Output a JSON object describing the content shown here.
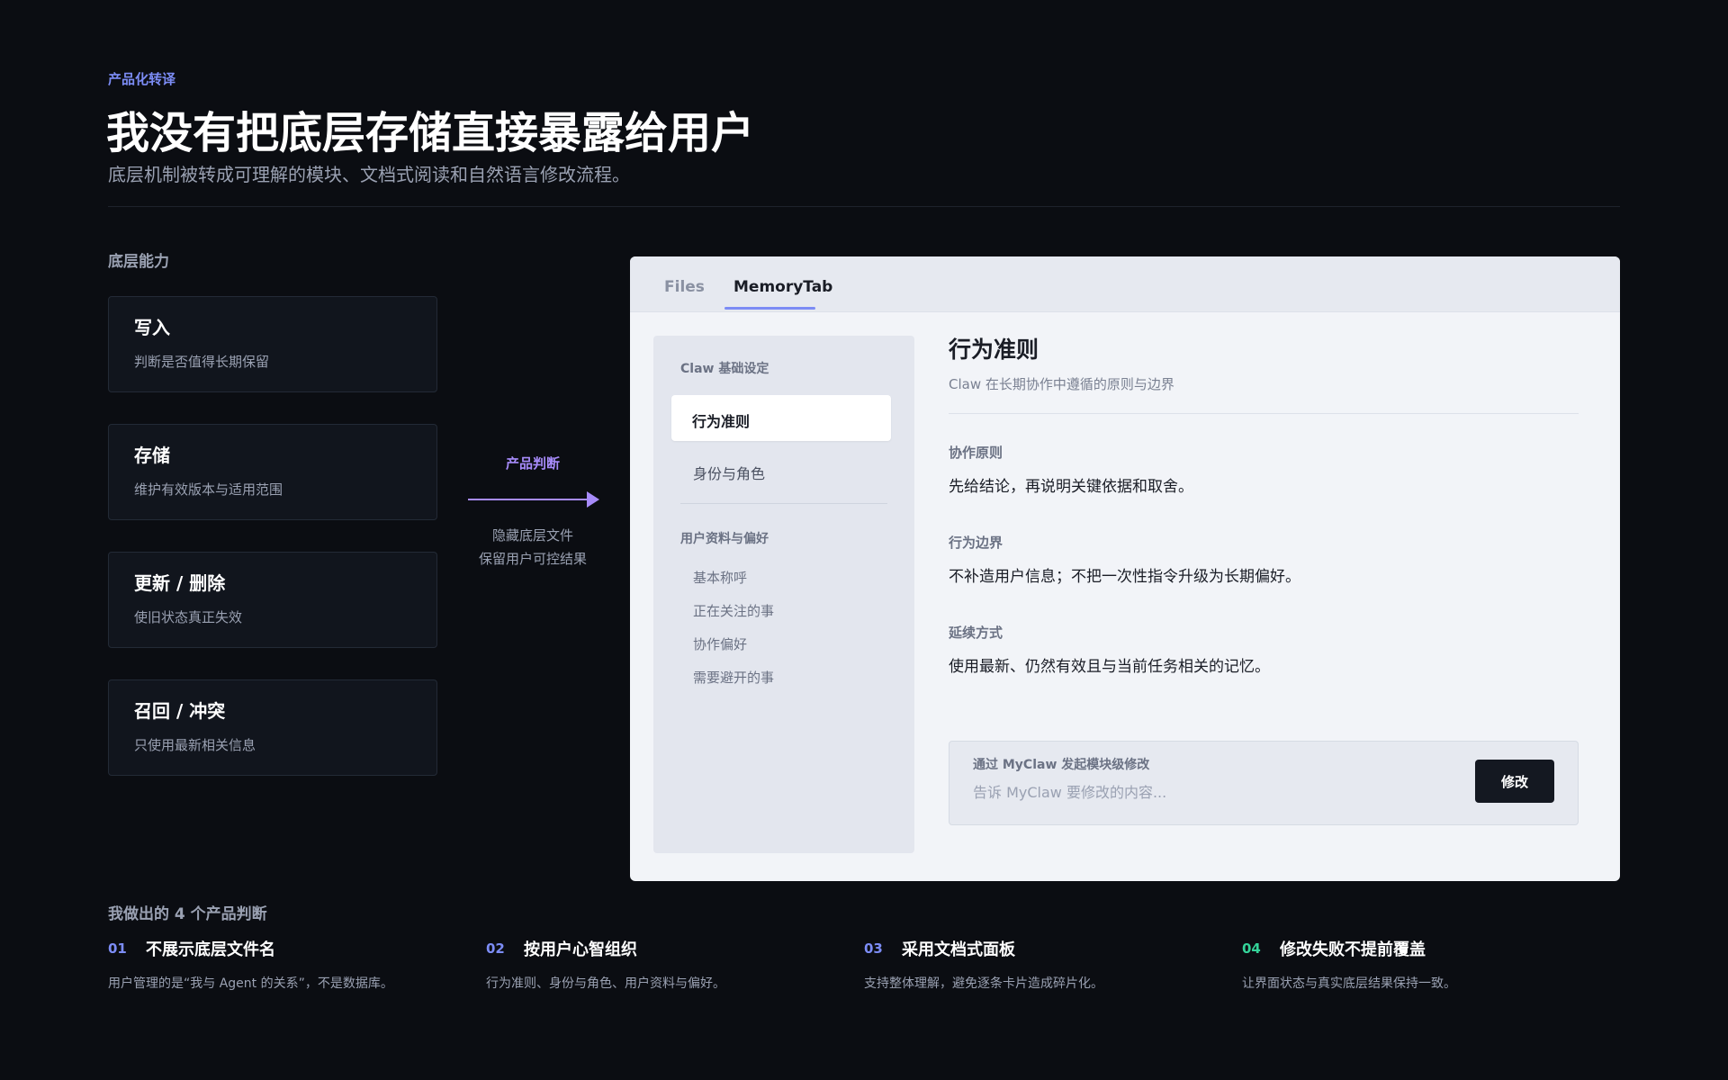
{
  "header": {
    "eyebrow": "产品化转译",
    "title": "我没有把底层存储直接暴露给用户",
    "subtitle": "底层机制被转成可理解的模块、文档式阅读和自然语言修改流程。"
  },
  "capabilities": {
    "label": "底层能力",
    "items": [
      {
        "title": "写入",
        "desc": "判断是否值得长期保留"
      },
      {
        "title": "存储",
        "desc": "维护有效版本与适用范围"
      },
      {
        "title": "更新 / 删除",
        "desc": "使旧状态真正失效"
      },
      {
        "title": "召回 / 冲突",
        "desc": "只使用最新相关信息"
      }
    ]
  },
  "arrow": {
    "label": "产品判断",
    "desc_line1": "隐藏底层文件",
    "desc_line2": "保留用户可控结果"
  },
  "panel": {
    "tabs": [
      {
        "label": "Files",
        "active": false
      },
      {
        "label": "MemoryTab",
        "active": true
      }
    ],
    "sidenav": {
      "group1": "Claw 基础设定",
      "group1_items": [
        "行为准则",
        "身份与角色"
      ],
      "group2": "用户资料与偏好",
      "group2_items": [
        "基本称呼",
        "正在关注的事",
        "协作偏好",
        "需要避开的事"
      ]
    },
    "doc": {
      "title": "行为准则",
      "subtitle": "Claw 在长期协作中遵循的原则与边界",
      "sections": [
        {
          "heading": "协作原则",
          "body": "先给结论，再说明关键依据和取舍。"
        },
        {
          "heading": "行为边界",
          "body": "不补造用户信息；不把一次性指令升级为长期偏好。"
        },
        {
          "heading": "延续方式",
          "body": "使用最新、仍然有效且与当前任务相关的记忆。"
        }
      ]
    },
    "edit": {
      "label": "通过 MyClaw 发起模块级修改",
      "placeholder": "告诉 MyClaw 要修改的内容...",
      "button": "修改"
    }
  },
  "judgments": {
    "label": "我做出的 4 个产品判断",
    "items": [
      {
        "num": "01",
        "title": "不展示底层文件名",
        "desc": "用户管理的是“我与 Agent 的关系”，不是数据库。",
        "color": "#7c8cf5"
      },
      {
        "num": "02",
        "title": "按用户心智组织",
        "desc": "行为准则、身份与角色、用户资料与偏好。",
        "color": "#7c8cf5"
      },
      {
        "num": "03",
        "title": "采用文档式面板",
        "desc": "支持整体理解，避免逐条卡片造成碎片化。",
        "color": "#7c8cf5"
      },
      {
        "num": "04",
        "title": "修改失败不提前覆盖",
        "desc": "让界面状态与真实底层结果保持一致。",
        "color": "#34d399"
      }
    ]
  },
  "colors": {
    "accent": "#7c8cf5",
    "purple": "#a78bfa",
    "green": "#34d399",
    "background": "#0b0d12"
  }
}
